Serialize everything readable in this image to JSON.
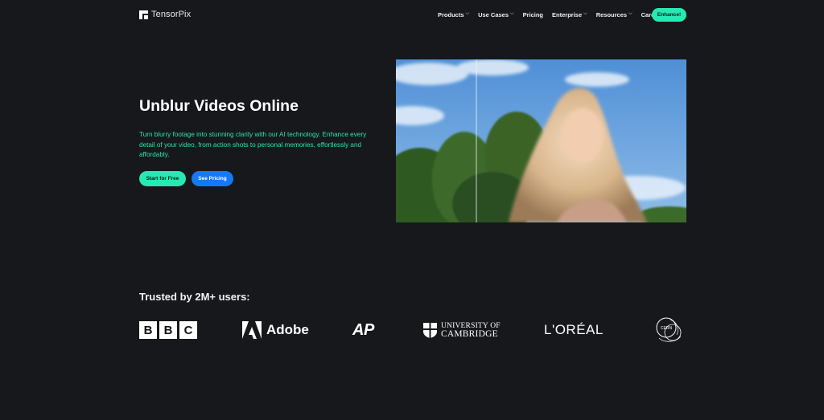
{
  "nav": {
    "brand": "TensorPix",
    "menu": [
      {
        "label": "Products",
        "has_dropdown": true
      },
      {
        "label": "Use Cases",
        "has_dropdown": true
      },
      {
        "label": "Pricing",
        "has_dropdown": false
      },
      {
        "label": "Enterprise",
        "has_dropdown": true
      },
      {
        "label": "Resources",
        "has_dropdown": true
      },
      {
        "label": "Careers",
        "has_dropdown": false
      }
    ],
    "cta": "Enhance!"
  },
  "hero": {
    "title": "Unblur Videos Online",
    "description": "Turn blurry footage into stunning clarity with our AI technology. Enhance every detail of your video, from action shots to personal memories, effortlessly and affordably.",
    "primary_button": "Start for Free",
    "secondary_button": "See Pricing"
  },
  "trusted": {
    "heading": "Trusted by 2M+ users:",
    "brands": {
      "bbc": [
        "B",
        "B",
        "C"
      ],
      "adobe": "Adobe",
      "ap": "AP",
      "cambridge_line1": "UNIVERSITY OF",
      "cambridge_line2": "CAMBRIDGE",
      "loreal": "L'ORÉAL",
      "cern": "CERN"
    }
  },
  "colors": {
    "background": "#16181b",
    "accent_green": "#28e8b4",
    "accent_blue": "#1479f4",
    "description_text": "#2fe3b0"
  },
  "icons": {
    "logo": "tensorpix-logo-icon",
    "dropdown": "chevron-down-icon"
  }
}
